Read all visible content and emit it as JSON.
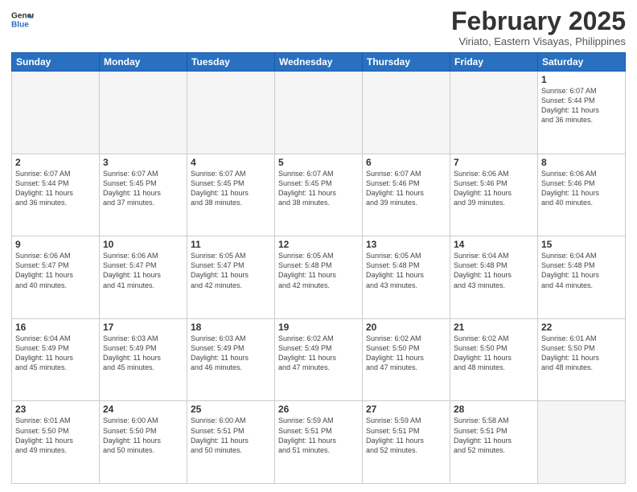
{
  "header": {
    "logo_line1": "General",
    "logo_line2": "Blue",
    "month_title": "February 2025",
    "location": "Viriato, Eastern Visayas, Philippines"
  },
  "days_of_week": [
    "Sunday",
    "Monday",
    "Tuesday",
    "Wednesday",
    "Thursday",
    "Friday",
    "Saturday"
  ],
  "weeks": [
    [
      {
        "day": "",
        "info": ""
      },
      {
        "day": "",
        "info": ""
      },
      {
        "day": "",
        "info": ""
      },
      {
        "day": "",
        "info": ""
      },
      {
        "day": "",
        "info": ""
      },
      {
        "day": "",
        "info": ""
      },
      {
        "day": "1",
        "info": "Sunrise: 6:07 AM\nSunset: 5:44 PM\nDaylight: 11 hours\nand 36 minutes."
      }
    ],
    [
      {
        "day": "2",
        "info": "Sunrise: 6:07 AM\nSunset: 5:44 PM\nDaylight: 11 hours\nand 36 minutes."
      },
      {
        "day": "3",
        "info": "Sunrise: 6:07 AM\nSunset: 5:45 PM\nDaylight: 11 hours\nand 37 minutes."
      },
      {
        "day": "4",
        "info": "Sunrise: 6:07 AM\nSunset: 5:45 PM\nDaylight: 11 hours\nand 38 minutes."
      },
      {
        "day": "5",
        "info": "Sunrise: 6:07 AM\nSunset: 5:45 PM\nDaylight: 11 hours\nand 38 minutes."
      },
      {
        "day": "6",
        "info": "Sunrise: 6:07 AM\nSunset: 5:46 PM\nDaylight: 11 hours\nand 39 minutes."
      },
      {
        "day": "7",
        "info": "Sunrise: 6:06 AM\nSunset: 5:46 PM\nDaylight: 11 hours\nand 39 minutes."
      },
      {
        "day": "8",
        "info": "Sunrise: 6:06 AM\nSunset: 5:46 PM\nDaylight: 11 hours\nand 40 minutes."
      }
    ],
    [
      {
        "day": "9",
        "info": "Sunrise: 6:06 AM\nSunset: 5:47 PM\nDaylight: 11 hours\nand 40 minutes."
      },
      {
        "day": "10",
        "info": "Sunrise: 6:06 AM\nSunset: 5:47 PM\nDaylight: 11 hours\nand 41 minutes."
      },
      {
        "day": "11",
        "info": "Sunrise: 6:05 AM\nSunset: 5:47 PM\nDaylight: 11 hours\nand 42 minutes."
      },
      {
        "day": "12",
        "info": "Sunrise: 6:05 AM\nSunset: 5:48 PM\nDaylight: 11 hours\nand 42 minutes."
      },
      {
        "day": "13",
        "info": "Sunrise: 6:05 AM\nSunset: 5:48 PM\nDaylight: 11 hours\nand 43 minutes."
      },
      {
        "day": "14",
        "info": "Sunrise: 6:04 AM\nSunset: 5:48 PM\nDaylight: 11 hours\nand 43 minutes."
      },
      {
        "day": "15",
        "info": "Sunrise: 6:04 AM\nSunset: 5:48 PM\nDaylight: 11 hours\nand 44 minutes."
      }
    ],
    [
      {
        "day": "16",
        "info": "Sunrise: 6:04 AM\nSunset: 5:49 PM\nDaylight: 11 hours\nand 45 minutes."
      },
      {
        "day": "17",
        "info": "Sunrise: 6:03 AM\nSunset: 5:49 PM\nDaylight: 11 hours\nand 45 minutes."
      },
      {
        "day": "18",
        "info": "Sunrise: 6:03 AM\nSunset: 5:49 PM\nDaylight: 11 hours\nand 46 minutes."
      },
      {
        "day": "19",
        "info": "Sunrise: 6:02 AM\nSunset: 5:49 PM\nDaylight: 11 hours\nand 47 minutes."
      },
      {
        "day": "20",
        "info": "Sunrise: 6:02 AM\nSunset: 5:50 PM\nDaylight: 11 hours\nand 47 minutes."
      },
      {
        "day": "21",
        "info": "Sunrise: 6:02 AM\nSunset: 5:50 PM\nDaylight: 11 hours\nand 48 minutes."
      },
      {
        "day": "22",
        "info": "Sunrise: 6:01 AM\nSunset: 5:50 PM\nDaylight: 11 hours\nand 48 minutes."
      }
    ],
    [
      {
        "day": "23",
        "info": "Sunrise: 6:01 AM\nSunset: 5:50 PM\nDaylight: 11 hours\nand 49 minutes."
      },
      {
        "day": "24",
        "info": "Sunrise: 6:00 AM\nSunset: 5:50 PM\nDaylight: 11 hours\nand 50 minutes."
      },
      {
        "day": "25",
        "info": "Sunrise: 6:00 AM\nSunset: 5:51 PM\nDaylight: 11 hours\nand 50 minutes."
      },
      {
        "day": "26",
        "info": "Sunrise: 5:59 AM\nSunset: 5:51 PM\nDaylight: 11 hours\nand 51 minutes."
      },
      {
        "day": "27",
        "info": "Sunrise: 5:59 AM\nSunset: 5:51 PM\nDaylight: 11 hours\nand 52 minutes."
      },
      {
        "day": "28",
        "info": "Sunrise: 5:58 AM\nSunset: 5:51 PM\nDaylight: 11 hours\nand 52 minutes."
      },
      {
        "day": "",
        "info": ""
      }
    ]
  ]
}
